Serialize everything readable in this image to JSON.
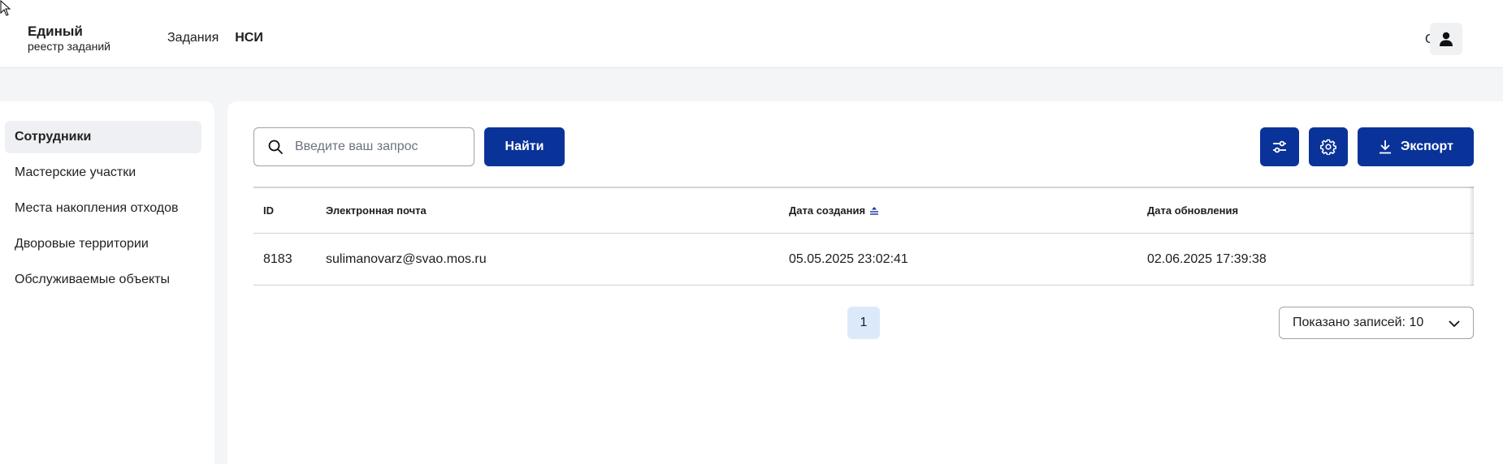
{
  "window": {
    "title": "Единый Реестр заданий - НСИ"
  },
  "header": {
    "logo_line1": "Единый",
    "logo_line2": "реестр заданий",
    "nav": [
      {
        "label": "Задания",
        "active": false
      },
      {
        "label": "НСИ",
        "active": true
      }
    ],
    "user_initial": "С."
  },
  "sidebar": {
    "items": [
      {
        "label": "Сотрудники",
        "selected": true
      },
      {
        "label": "Мастерские участки"
      },
      {
        "label": "Места накопления отходов"
      },
      {
        "label": "Дворовые территории"
      },
      {
        "label": "Обслуживаемые объекты"
      }
    ]
  },
  "toolbar": {
    "search_placeholder": "Введите ваш запрос",
    "search_value": "",
    "find_label": "Найти",
    "export_label": "Экспорт"
  },
  "table": {
    "headers": [
      "ID",
      "Электронная почта",
      "Дата создания",
      "Дата обновления"
    ],
    "rows": [
      [
        "8183",
        "sulimanovarz@svao.mos.ru",
        "05.05.2025 23:02:41",
        "02.06.2025 17:39:38"
      ]
    ]
  },
  "pagination": {
    "current_page": "1",
    "page_size_label": "Показано записей: 10"
  },
  "colors": {
    "primary": "#0a3399",
    "page_active_bg": "#dce9fb"
  }
}
